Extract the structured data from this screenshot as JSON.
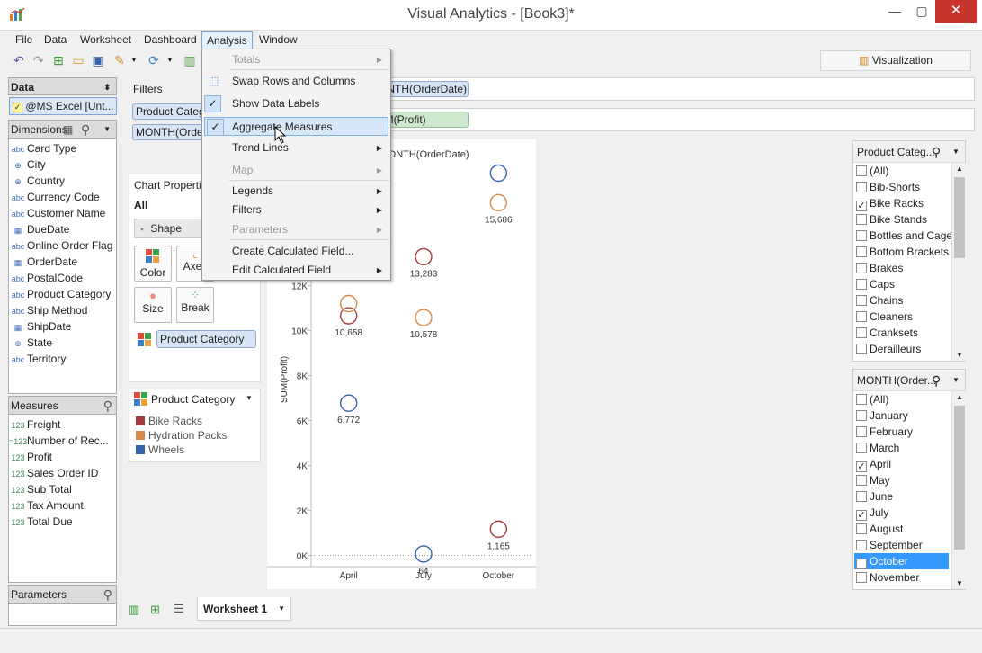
{
  "window": {
    "title": "Visual Analytics - [Book3]*",
    "minimize": "—",
    "maximize": "▢",
    "close": "✕"
  },
  "menubar": [
    "File",
    "Data",
    "Worksheet",
    "Dashboard",
    "Analysis",
    "Window"
  ],
  "toolbar": {
    "visualization_tab": "Visualization"
  },
  "data_panel": {
    "title": "Data",
    "source": "@MS Excel [Unt...",
    "dimensions_title": "Dimensions",
    "dimensions": [
      {
        "type": "abc",
        "label": "Card Type"
      },
      {
        "type": "geo",
        "label": "City"
      },
      {
        "type": "geo",
        "label": "Country"
      },
      {
        "type": "abc",
        "label": "Currency Code"
      },
      {
        "type": "abc",
        "label": "Customer Name"
      },
      {
        "type": "date",
        "label": "DueDate"
      },
      {
        "type": "abc",
        "label": "Online Order Flag"
      },
      {
        "type": "date",
        "label": "OrderDate"
      },
      {
        "type": "abc",
        "label": "PostalCode"
      },
      {
        "type": "abc",
        "label": "Product Category"
      },
      {
        "type": "abc",
        "label": "Ship Method"
      },
      {
        "type": "date",
        "label": "ShipDate"
      },
      {
        "type": "geo",
        "label": "State"
      },
      {
        "type": "abc",
        "label": "Territory"
      }
    ],
    "measures_title": "Measures",
    "measures": [
      {
        "type": "123",
        "label": "Freight"
      },
      {
        "type": "calc",
        "label": "Number of Rec..."
      },
      {
        "type": "123",
        "label": "Profit"
      },
      {
        "type": "123",
        "label": "Sales Order ID"
      },
      {
        "type": "123",
        "label": "Sub Total"
      },
      {
        "type": "123",
        "label": "Tax Amount"
      },
      {
        "type": "123",
        "label": "Total Due"
      }
    ],
    "parameters_title": "Parameters"
  },
  "filters_shelf": {
    "title": "Filters",
    "pills": [
      "Product Categor",
      "MONTH(OrderDa"
    ]
  },
  "columns_pill": "MONTH(OrderDate)",
  "rows_pill": "SUM(Profit)",
  "chart_properties": {
    "title": "Chart Properties",
    "all_label": "All",
    "mark_type": "Shape",
    "buttons": [
      "Color",
      "Axes",
      "Size",
      "Break"
    ],
    "color_field": "Product Category"
  },
  "legend": {
    "title": "Product Category",
    "items": [
      {
        "label": "Bike Racks",
        "color": "#a23b3b"
      },
      {
        "label": "Hydration Packs",
        "color": "#d9894a"
      },
      {
        "label": "Wheels",
        "color": "#3a62a8"
      }
    ]
  },
  "analysis_menu": {
    "items": [
      {
        "label": "Totals",
        "disabled": true,
        "submenu": true
      },
      {
        "label": "Swap Rows and Columns"
      },
      {
        "label": "Show Data Labels",
        "checked": true
      },
      {
        "label": "Aggregate Measures",
        "checked": true,
        "highlight": true
      },
      {
        "label": "Trend Lines",
        "submenu": true
      },
      {
        "label": "Map",
        "disabled": true,
        "submenu": true
      },
      {
        "label": "Legends",
        "submenu": true
      },
      {
        "label": "Filters",
        "submenu": true
      },
      {
        "label": "Parameters",
        "disabled": true,
        "submenu": true
      },
      {
        "label": "Create Calculated Field..."
      },
      {
        "label": "Edit Calculated Field",
        "submenu": true
      }
    ]
  },
  "chart_data": {
    "type": "scatter",
    "xlabel": "MONTH(OrderDate)",
    "ylabel": "SUM(Profit)",
    "categories": [
      "April",
      "July",
      "October"
    ],
    "ylim": [
      -500,
      17500
    ],
    "yticks": [
      {
        "value": 0,
        "label": "0K"
      },
      {
        "value": 2000,
        "label": "2K"
      },
      {
        "value": 4000,
        "label": "4K"
      },
      {
        "value": 6000,
        "label": "6K"
      },
      {
        "value": 8000,
        "label": "8K"
      },
      {
        "value": 10000,
        "label": "10K"
      },
      {
        "value": 12000,
        "label": "12K"
      }
    ],
    "points": [
      {
        "series": "Wheels",
        "x": "April",
        "y": 6772,
        "label": "6,772",
        "color": "#3a62a8"
      },
      {
        "series": "Bike Racks",
        "x": "April",
        "y": 10658,
        "label": "10,658",
        "color": "#a23b3b"
      },
      {
        "series": "Hydration Packs",
        "x": "April",
        "y": 11200,
        "label": "",
        "color": "#d9894a"
      },
      {
        "series": "Wheels",
        "x": "July",
        "y": 64,
        "label": "64",
        "color": "#3a62a8"
      },
      {
        "series": "Hydration Packs",
        "x": "July",
        "y": 10578,
        "label": "10,578",
        "color": "#d9894a"
      },
      {
        "series": "Bike Racks",
        "x": "July",
        "y": 13283,
        "label": "13,283",
        "color": "#a23b3b"
      },
      {
        "series": "Bike Racks",
        "x": "October",
        "y": 1165,
        "label": "1,165",
        "color": "#a23b3b"
      },
      {
        "series": "Hydration Packs",
        "x": "October",
        "y": 15686,
        "label": "15,686",
        "color": "#d9894a"
      },
      {
        "series": "Wheels",
        "x": "October",
        "y": 17000,
        "label": "",
        "color": "#3a62a8"
      }
    ]
  },
  "product_filter": {
    "title": "Product Categ...",
    "items": [
      {
        "label": "(All)",
        "checked": false
      },
      {
        "label": "Bib-Shorts",
        "checked": false
      },
      {
        "label": "Bike Racks",
        "checked": true
      },
      {
        "label": "Bike Stands",
        "checked": false
      },
      {
        "label": "Bottles and Cages",
        "checked": false
      },
      {
        "label": "Bottom Brackets",
        "checked": false
      },
      {
        "label": "Brakes",
        "checked": false
      },
      {
        "label": "Caps",
        "checked": false
      },
      {
        "label": "Chains",
        "checked": false
      },
      {
        "label": "Cleaners",
        "checked": false
      },
      {
        "label": "Cranksets",
        "checked": false
      },
      {
        "label": "Derailleurs",
        "checked": false
      }
    ]
  },
  "month_filter": {
    "title": "MONTH(Order...",
    "items": [
      {
        "label": "(All)",
        "checked": false
      },
      {
        "label": "January",
        "checked": false
      },
      {
        "label": "February",
        "checked": false
      },
      {
        "label": "March",
        "checked": false
      },
      {
        "label": "April",
        "checked": true
      },
      {
        "label": "May",
        "checked": false
      },
      {
        "label": "June",
        "checked": false
      },
      {
        "label": "July",
        "checked": true
      },
      {
        "label": "August",
        "checked": false
      },
      {
        "label": "September",
        "checked": false
      },
      {
        "label": "October",
        "checked": true,
        "selected": true
      },
      {
        "label": "November",
        "checked": false
      }
    ]
  },
  "worksheet_tab": "Worksheet 1"
}
